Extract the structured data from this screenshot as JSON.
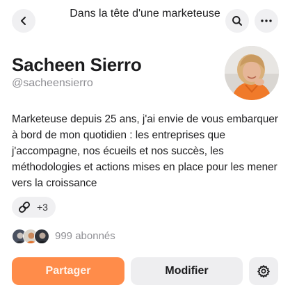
{
  "header": {
    "title": "Dans la tête d'une marketeuse"
  },
  "profile": {
    "name": "Sacheen Sierro",
    "handle": "@sacheensierro",
    "bio": "Marketeuse depuis 25 ans, j'ai envie de vous embarquer à bord de mon quotidien : les entreprises que j'accompagne, nos écueils et nos succès, les méthodologies et actions mises en place pour les mener vers la croissance",
    "links_count": "+3",
    "subscribers_text": "999 abonnés"
  },
  "actions": {
    "share_label": "Partager",
    "edit_label": "Modifier"
  },
  "icons": {
    "back": "chevron-left-icon",
    "search": "search-icon",
    "more": "more-horizontal-icon",
    "link": "link-icon",
    "settings": "gear-icon"
  },
  "colors": {
    "accent": "#ff8c4a",
    "chip_bg": "#f0f0f2",
    "muted_text": "#8e8e93"
  }
}
